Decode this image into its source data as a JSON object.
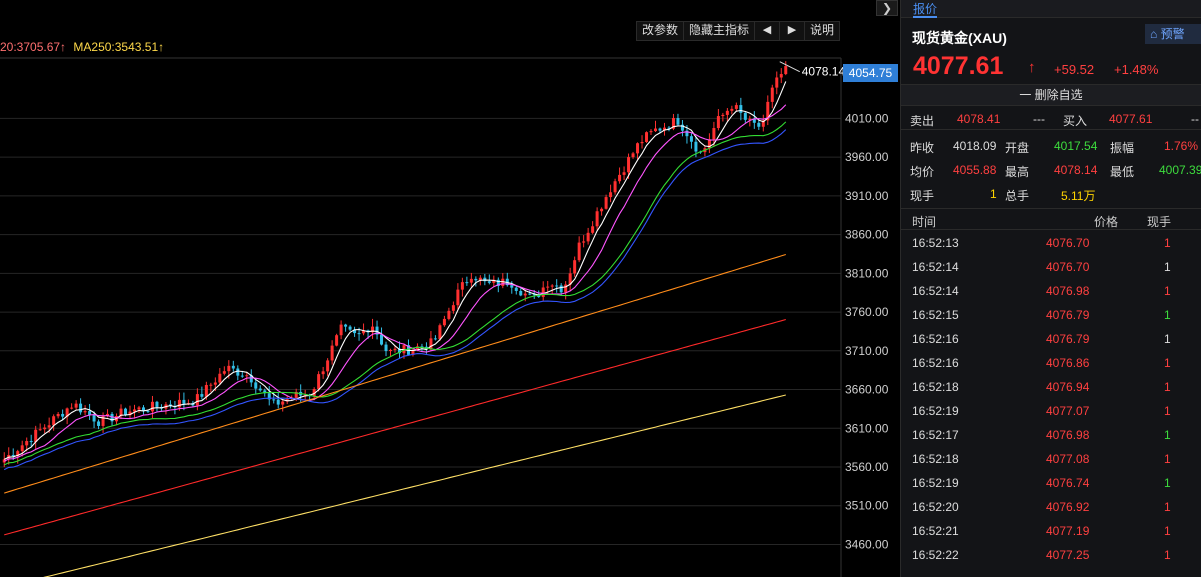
{
  "chart": {
    "ma_legend": {
      "ma_a_text": "20:3705.67↑",
      "ma_b_text": "MA250:3543.51↑"
    },
    "toolbar": {
      "params": "改参数",
      "hide_main": "隐藏主指标",
      "prev": "◀",
      "next": "▶",
      "help": "说明"
    },
    "collapse": "❯",
    "current_price_tag": "4054.75",
    "high_marker_label": "4078.14"
  },
  "chart_data": {
    "type": "candlestick",
    "y_ticks": [
      4010.0,
      3960.0,
      3910.0,
      3860.0,
      3810.0,
      3760.0,
      3710.0,
      3660.0,
      3610.0,
      3560.0,
      3510.0,
      3460.0
    ],
    "ylim": [
      3418,
      4088
    ],
    "candle_count": 175,
    "ohlc_anchors": [
      [
        0,
        3570
      ],
      [
        10,
        3610
      ],
      [
        18,
        3642
      ],
      [
        25,
        3618
      ],
      [
        32,
        3632
      ],
      [
        42,
        3640
      ],
      [
        50,
        3646
      ],
      [
        58,
        3688
      ],
      [
        64,
        3678
      ],
      [
        70,
        3640
      ],
      [
        76,
        3652
      ],
      [
        80,
        3655
      ],
      [
        88,
        3738
      ],
      [
        92,
        3728
      ],
      [
        96,
        3745
      ],
      [
        100,
        3708
      ],
      [
        106,
        3712
      ],
      [
        112,
        3720
      ],
      [
        118,
        3782
      ],
      [
        122,
        3810
      ],
      [
        126,
        3795
      ],
      [
        132,
        3800
      ],
      [
        138,
        3775
      ],
      [
        142,
        3800
      ],
      [
        146,
        3790
      ],
      [
        150,
        3845
      ],
      [
        158,
        3918
      ],
      [
        166,
        3980
      ],
      [
        170,
        3995
      ],
      [
        176,
        4008
      ],
      [
        182,
        3963
      ],
      [
        186,
        4005
      ],
      [
        190,
        4028
      ],
      [
        194,
        4005
      ],
      [
        198,
        3998
      ],
      [
        201,
        4062
      ],
      [
        204,
        4066
      ]
    ],
    "series": [
      {
        "name": "MA5",
        "color": "#ffffff"
      },
      {
        "name": "MA10",
        "color": "#ff55ff"
      },
      {
        "name": "MA20",
        "color": "#33dd33"
      },
      {
        "name": "MA30",
        "color": "#3355ff"
      },
      {
        "name": "MA60",
        "color": "#ff8c1a"
      },
      {
        "name": "MA120",
        "color": "#ff2a2a"
      },
      {
        "name": "MA250",
        "color": "#ffe066"
      }
    ],
    "colors": {
      "up": "#ff3030",
      "down": "#33c0e8",
      "grid": "#262626"
    }
  },
  "quote": {
    "tab": "报价",
    "symbol": "现货黄金(XAU)",
    "alert": "预警",
    "price": "4077.61",
    "arrow": "↑",
    "change": "+59.52",
    "change_pct": "+1.48%",
    "watchlist_btn": "一 删除自选",
    "sell_label": "卖出",
    "sell": "4078.41",
    "sell_qty": "---",
    "buy_label": "买入",
    "buy": "4077.61",
    "buy_qty": "--",
    "prev_close_label": "昨收",
    "prev_close": "4018.09",
    "open_label": "开盘",
    "open": "4017.54",
    "amp_label": "振幅",
    "amp": "1.76%",
    "avg_label": "均价",
    "avg": "4055.88",
    "high_label": "最高",
    "high": "4078.14",
    "low_label": "最低",
    "low": "4007.39",
    "cur_vol_label": "现手",
    "cur_vol": "1",
    "total_vol_label": "总手",
    "total_vol": "5.11万"
  },
  "ticks": {
    "header": {
      "time": "时间",
      "price": "价格",
      "vol": "现手"
    },
    "rows": [
      {
        "time": "16:52:13",
        "price": "4076.70",
        "vol": "1",
        "dir": "red"
      },
      {
        "time": "16:52:14",
        "price": "4076.70",
        "vol": "1",
        "dir": "white"
      },
      {
        "time": "16:52:14",
        "price": "4076.98",
        "vol": "1",
        "dir": "red"
      },
      {
        "time": "16:52:15",
        "price": "4076.79",
        "vol": "1",
        "dir": "green"
      },
      {
        "time": "16:52:16",
        "price": "4076.79",
        "vol": "1",
        "dir": "white"
      },
      {
        "time": "16:52:16",
        "price": "4076.86",
        "vol": "1",
        "dir": "red"
      },
      {
        "time": "16:52:18",
        "price": "4076.94",
        "vol": "1",
        "dir": "red"
      },
      {
        "time": "16:52:19",
        "price": "4077.07",
        "vol": "1",
        "dir": "red"
      },
      {
        "time": "16:52:17",
        "price": "4076.98",
        "vol": "1",
        "dir": "green"
      },
      {
        "time": "16:52:18",
        "price": "4077.08",
        "vol": "1",
        "dir": "red"
      },
      {
        "time": "16:52:19",
        "price": "4076.74",
        "vol": "1",
        "dir": "green"
      },
      {
        "time": "16:52:20",
        "price": "4076.92",
        "vol": "1",
        "dir": "red"
      },
      {
        "time": "16:52:21",
        "price": "4077.19",
        "vol": "1",
        "dir": "red"
      },
      {
        "time": "16:52:22",
        "price": "4077.25",
        "vol": "1",
        "dir": "red"
      }
    ]
  }
}
